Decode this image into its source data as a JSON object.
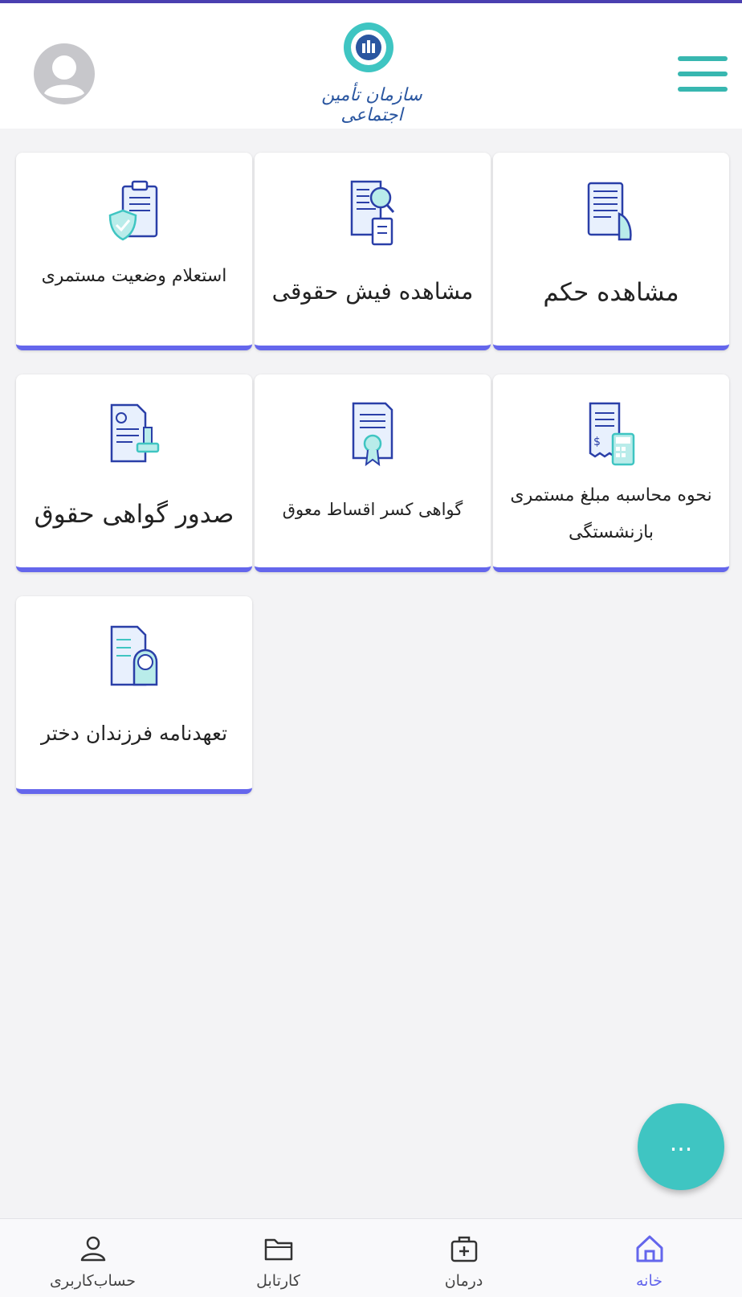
{
  "app": {
    "logo_text": "سازمان تأمین اجتماعی",
    "accent_color": "#6466ec",
    "teal_color": "#3fc5c2"
  },
  "header": {
    "avatar_icon": "user-circle-icon",
    "menu_icon": "hamburger-menu-icon"
  },
  "tiles": [
    {
      "label": "مشاهده حکم",
      "icon": "document-hand-icon"
    },
    {
      "label": "مشاهده فیش حقوقی",
      "icon": "payslip-search-icon"
    },
    {
      "label": "استعلام وضعیت مستمری",
      "icon": "clipboard-shield-icon"
    },
    {
      "label": "نحوه محاسبه مبلغ مستمری بازنشستگی",
      "icon": "receipt-calculator-icon"
    },
    {
      "label": "گواهی کسر اقساط معوق",
      "icon": "certificate-ribbon-icon"
    },
    {
      "label": "صدور گواهی حقوق",
      "icon": "document-stamp-icon"
    },
    {
      "label": "تعهدنامه فرزندان دختر",
      "icon": "document-girl-icon"
    }
  ],
  "fab": {
    "label": "...",
    "icon": "more-dots-icon"
  },
  "bottom_nav": {
    "items": [
      {
        "label": "خانه",
        "icon": "home-icon",
        "active": true
      },
      {
        "label": "درمان",
        "icon": "medical-kit-icon",
        "active": false
      },
      {
        "label": "کارتابل",
        "icon": "folder-icon",
        "active": false
      },
      {
        "label": "حساب‌کاربری",
        "icon": "user-icon",
        "active": false
      }
    ]
  }
}
